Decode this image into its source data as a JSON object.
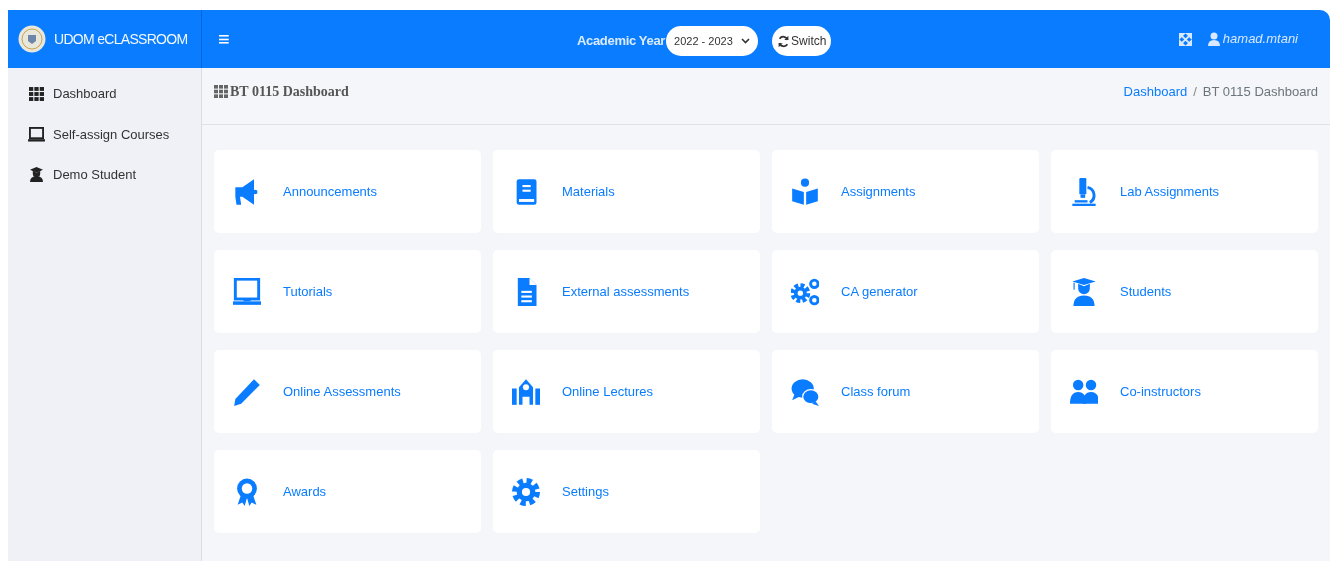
{
  "brand": {
    "title": "UDOM eCLASSROOM"
  },
  "header": {
    "menu_glyph": "≡",
    "year_label": "Academic Year",
    "year_value": "2022 - 2023",
    "switch_button": "Switch",
    "user": "hamad.mtani"
  },
  "sidebar": {
    "items": [
      {
        "label": "Dashboard"
      },
      {
        "label": "Self-assign Courses"
      },
      {
        "label": "Demo Student"
      }
    ]
  },
  "page": {
    "title": "BT 0115 Dashboard",
    "breadcrumb": [
      "Dashboard",
      "BT 0115 Dashboard"
    ],
    "breadcrumb_separator": "/"
  },
  "tiles": [
    {
      "label": "Announcements"
    },
    {
      "label": "Materials"
    },
    {
      "label": "Assignments"
    },
    {
      "label": "Lab Assignments"
    },
    {
      "label": "Tutorials"
    },
    {
      "label": "External assessments"
    },
    {
      "label": "CA generator"
    },
    {
      "label": "Students"
    },
    {
      "label": "Online Assessments"
    },
    {
      "label": "Online Lectures"
    },
    {
      "label": "Class forum"
    },
    {
      "label": "Co-instructors"
    },
    {
      "label": "Awards"
    },
    {
      "label": "Settings"
    }
  ]
}
